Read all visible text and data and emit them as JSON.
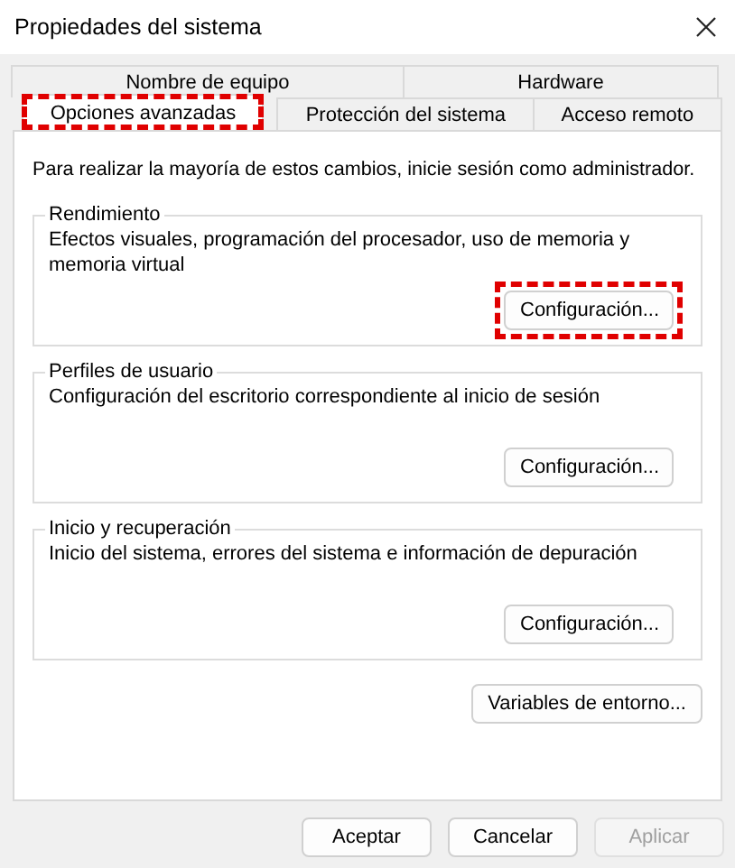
{
  "window": {
    "title": "Propiedades del sistema"
  },
  "tab_rows": [
    {
      "tabs": [
        {
          "label": "Nombre de equipo",
          "selected": false,
          "highlighted": false
        },
        {
          "label": "Hardware",
          "selected": false,
          "highlighted": false
        }
      ]
    },
    {
      "tabs": [
        {
          "label": "Opciones avanzadas",
          "selected": true,
          "highlighted": true
        },
        {
          "label": "Protección del sistema",
          "selected": false,
          "highlighted": false
        },
        {
          "label": "Acceso remoto",
          "selected": false,
          "highlighted": false
        }
      ]
    }
  ],
  "notice": "Para realizar la mayoría de estos cambios, inicie sesión como administrador.",
  "groups": [
    {
      "title": "Rendimiento",
      "description": "Efectos visuales, programación del procesador, uso de memoria y memoria virtual",
      "button": {
        "label": "Configuración...",
        "highlighted": true
      }
    },
    {
      "title": "Perfiles de usuario",
      "description": "Configuración del escritorio correspondiente al inicio de sesión",
      "button": {
        "label": "Configuración...",
        "highlighted": false
      }
    },
    {
      "title": "Inicio y recuperación",
      "description": "Inicio del sistema, errores del sistema e información de depuración",
      "button": {
        "label": "Configuración...",
        "highlighted": false
      }
    }
  ],
  "environment_button": {
    "label": "Variables de entorno...",
    "highlighted": false
  },
  "buttons": [
    {
      "label": "Aceptar",
      "disabled": false
    },
    {
      "label": "Cancelar",
      "disabled": false
    },
    {
      "label": "Aplicar",
      "disabled": true
    }
  ]
}
